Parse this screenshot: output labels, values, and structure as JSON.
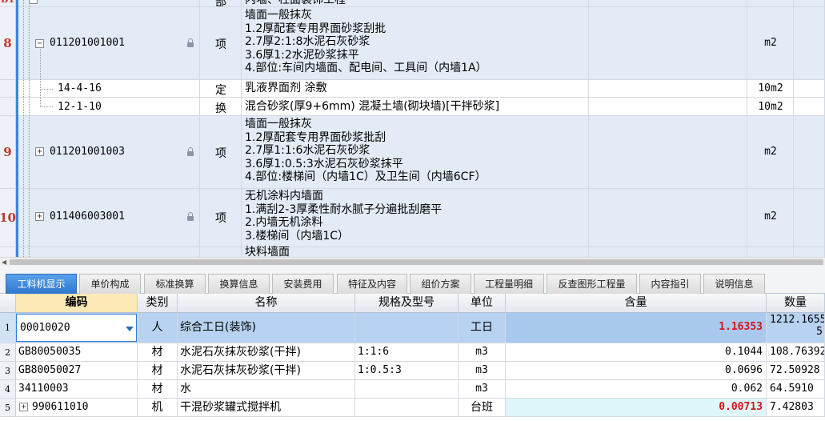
{
  "top_grid": {
    "partial_header": {
      "rownum": "B1",
      "cat": "部",
      "desc": "内墙、柱面装饰工程"
    },
    "rows": [
      {
        "num": "8",
        "expander": "−",
        "code": "011201001001",
        "cat": "项",
        "desc": "墙面一般抹灰\n1.2厚配套专用界面砂浆刮批\n2.7厚2:1:8水泥石灰砂浆\n3.6厚1:2水泥砂浆抹平\n4.部位:车间内墙面、配电间、工具间（内墙1A）",
        "unit": "m2",
        "locked": true
      },
      {
        "code": "14-4-16",
        "cat": "定",
        "desc": "乳液界面剂 涂敷",
        "unit": "10m2"
      },
      {
        "code": "12-1-10",
        "cat": "换",
        "desc": "混合砂浆(厚9+6mm) 混凝土墙(砌块墙)[干拌砂浆]",
        "unit": "10m2"
      },
      {
        "num": "9",
        "expander": "+",
        "code": "011201001003",
        "cat": "项",
        "desc": "墙面一般抹灰\n1.2厚配套专用界面砂浆批刮\n2.7厚1:1:6水泥石灰砂浆\n3.6厚1:0.5:3水泥石灰砂浆抹平\n4.部位:楼梯间（内墙1C）及卫生间（内墙6CF）",
        "unit": "m2",
        "locked": true
      },
      {
        "num": "10",
        "expander": "+",
        "code": "011406003001",
        "cat": "项",
        "desc": "无机涂料内墙面\n1.满刮2-3厚柔性耐水腻子分遍批刮磨平\n2.内墙无机涂料\n3.楼梯间（内墙1C）",
        "unit": "m2",
        "locked": true
      },
      {
        "desc": "块料墙面"
      }
    ]
  },
  "tabs": [
    {
      "label": "工料机显示",
      "active": true
    },
    {
      "label": "单价构成"
    },
    {
      "label": "标准换算"
    },
    {
      "label": "换算信息"
    },
    {
      "label": "安装费用"
    },
    {
      "label": "特征及内容"
    },
    {
      "label": "组价方案"
    },
    {
      "label": "工程量明细"
    },
    {
      "label": "反查图形工程量"
    },
    {
      "label": "内容指引"
    },
    {
      "label": "说明信息"
    }
  ],
  "bottom_grid": {
    "headers": [
      "编码",
      "类别",
      "名称",
      "规格及型号",
      "单位",
      "含量",
      "数量"
    ],
    "rows": [
      {
        "num": "1",
        "code": "00010020",
        "cat": "人",
        "name": "综合工日(装饰)",
        "spec": "",
        "unit": "工日",
        "qty": "1.16353",
        "amount": "1212.1655",
        "amount2": "5"
      },
      {
        "num": "2",
        "code": "GB80050035",
        "cat": "材",
        "name": "水泥石灰抹灰砂浆(干拌)",
        "spec": "1:1:6",
        "unit": "m3",
        "qty": "0.1044",
        "amount": "108.76392"
      },
      {
        "num": "3",
        "code": "GB80050027",
        "cat": "材",
        "name": "水泥石灰抹灰砂浆(干拌)",
        "spec": "1:0.5:3",
        "unit": "m3",
        "qty": "0.0696",
        "amount": "72.50928"
      },
      {
        "num": "4",
        "code": "34110003",
        "cat": "材",
        "name": "水",
        "spec": "",
        "unit": "m3",
        "qty": "0.062",
        "amount": "64.5910"
      },
      {
        "num": "5",
        "code": "990611010",
        "expander": "+",
        "cat": "机",
        "name": "干混砂浆罐式搅拌机",
        "spec": "",
        "unit": "台班",
        "qty": "0.00713",
        "amount": "7.42803"
      }
    ]
  }
}
